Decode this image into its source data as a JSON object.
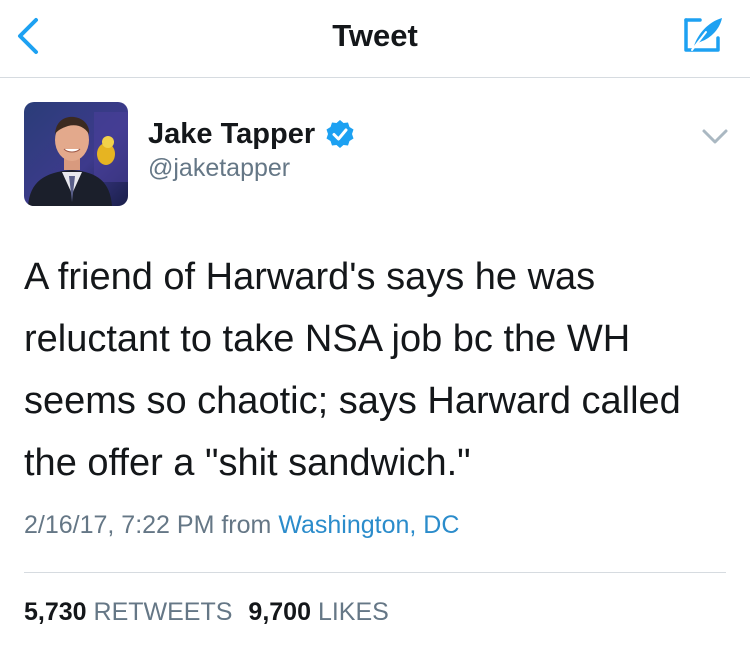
{
  "nav": {
    "title": "Tweet",
    "back_icon": "chevron-left-icon",
    "compose_icon": "compose-feather-icon",
    "accent_color": "#1da1f2"
  },
  "author": {
    "name": "Jake Tapper",
    "handle": "@jaketapper",
    "verified": true,
    "verified_color": "#1da1f2",
    "avatar_icon": "profile-photo"
  },
  "tweet": {
    "text": "A friend of Harward's says he was reluctant to take NSA job bc the WH seems so chaotic; says Harward called the offer a \"shit sandwich.\"",
    "timestamp": "2/16/17, 7:22 PM",
    "from_label": "from",
    "location": "Washington, DC",
    "location_color": "#2b8ccb"
  },
  "stats": {
    "retweets_count": "5,730",
    "retweets_label": "RETWEETS",
    "likes_count": "9,700",
    "likes_label": "LIKES"
  }
}
